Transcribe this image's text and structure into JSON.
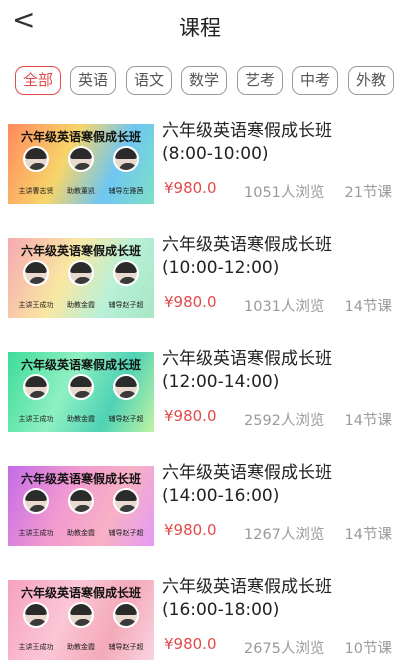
{
  "header": {
    "title": "课程",
    "back_icon": "chevron-left-icon",
    "back_glyph": "<"
  },
  "tabs": [
    {
      "label": "全部",
      "active": true
    },
    {
      "label": "英语",
      "active": false
    },
    {
      "label": "语文",
      "active": false
    },
    {
      "label": "数学",
      "active": false
    },
    {
      "label": "艺考",
      "active": false
    },
    {
      "label": "中考",
      "active": false
    },
    {
      "label": "外教",
      "active": false
    }
  ],
  "accent_color": "#e24a4a",
  "courses": [
    {
      "title": "六年级英语寒假成长班",
      "time": "(8:00-10:00)",
      "price": "¥980.0",
      "views": "1051人浏览",
      "lessons": "21节课",
      "thumb_title": "六年级英语寒假成长班",
      "teachers": [
        "主讲曹志贤",
        "助教董凯",
        "辅导左雅茜"
      ],
      "thumb_colors": [
        "#ff8a5c",
        "#f7d56b",
        "#6ec6f2",
        "#7fe0c5"
      ]
    },
    {
      "title": "六年级英语寒假成长班",
      "time": "(10:00-12:00)",
      "price": "¥980.0",
      "views": "1031人浏览",
      "lessons": "14节课",
      "thumb_title": "六年级英语寒假成长班",
      "teachers": [
        "主讲王成功",
        "助教金霞",
        "辅导赵子超"
      ],
      "thumb_colors": [
        "#f6a8b2",
        "#f9e7a2",
        "#b8f0d8",
        "#a7e7c4"
      ]
    },
    {
      "title": "六年级英语寒假成长班",
      "time": "(12:00-14:00)",
      "price": "¥980.0",
      "views": "2592人浏览",
      "lessons": "14节课",
      "thumb_title": "六年级英语寒假成长班",
      "teachers": [
        "主讲王成功",
        "助教金霞",
        "辅导赵子超"
      ],
      "thumb_colors": [
        "#3ddc9a",
        "#8ff0c2",
        "#4fd2b5",
        "#bff3a3"
      ]
    },
    {
      "title": "六年级英语寒假成长班",
      "time": "(14:00-16:00)",
      "price": "¥980.0",
      "views": "1267人浏览",
      "lessons": "14节课",
      "thumb_title": "六年级英语寒假成长班",
      "teachers": [
        "主讲王成功",
        "助教金霞",
        "辅导赵子超"
      ],
      "thumb_colors": [
        "#c46be8",
        "#f29ad0",
        "#f7b1c4",
        "#e59af5"
      ]
    },
    {
      "title": "六年级英语寒假成长班",
      "time": "(16:00-18:00)",
      "price": "¥980.0",
      "views": "2675人浏览",
      "lessons": "10节课",
      "thumb_title": "六年级英语寒假成长班",
      "teachers": [
        "主讲王成功",
        "助教金霞",
        "辅导赵子超"
      ],
      "thumb_colors": [
        "#f7a1c0",
        "#fbc6d6",
        "#f4a9b9",
        "#f9d4e1"
      ]
    }
  ]
}
